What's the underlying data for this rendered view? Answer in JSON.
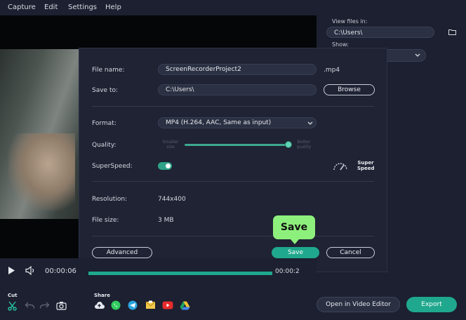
{
  "menu": {
    "items": [
      {
        "label": "Capture"
      },
      {
        "label": "Edit"
      },
      {
        "label": "Settings"
      },
      {
        "label": "Help"
      }
    ]
  },
  "side_panel": {
    "view_files_label": "View files in:",
    "view_files_path": "C:\\Users\\",
    "show_label": "Show:"
  },
  "dialog": {
    "file_name_label": "File name:",
    "file_name_value": "ScreenRecorderProject2",
    "extension": ".mp4",
    "save_to_label": "Save to:",
    "save_to_value": "C:\\Users\\",
    "browse_label": "Browse",
    "format_label": "Format:",
    "format_value": "MP4 (H.264, AAC, Same as input)",
    "quality_label": "Quality:",
    "quality_min_label": "Smaller size",
    "quality_max_label": "Better quality",
    "quality_level": 1.0,
    "superspeed_label": "SuperSpeed:",
    "superspeed_enabled": true,
    "superspeed_badge": "Super Speed",
    "resolution_label": "Resolution:",
    "resolution_value": "744x400",
    "file_size_label": "File size:",
    "file_size_value": "3 MB",
    "advanced_label": "Advanced",
    "save_label": "Save",
    "cancel_label": "Cancel"
  },
  "tooltip": {
    "text": "Save"
  },
  "player": {
    "current_time": "00:00:06",
    "end_time": "00:00:2"
  },
  "bottom": {
    "cut_label": "Cut",
    "share_label": "Share",
    "open_editor_label": "Open in Video Editor",
    "export_label": "Export"
  },
  "colors": {
    "accent": "#1fa88d",
    "tooltip": "#8ef07c",
    "background": "#1c2030",
    "dialog": "#1f2334"
  }
}
